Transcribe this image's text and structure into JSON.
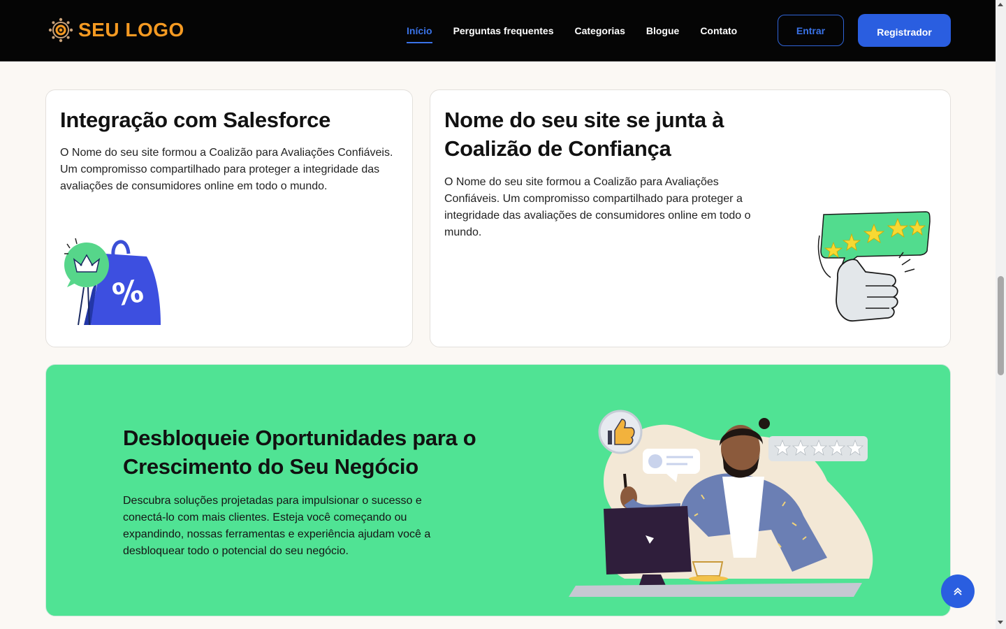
{
  "header": {
    "logo_text": "SEU LOGO",
    "nav": [
      {
        "label": "Início",
        "active": true
      },
      {
        "label": "Perguntas frequentes",
        "active": false
      },
      {
        "label": "Categorias",
        "active": false
      },
      {
        "label": "Blogue",
        "active": false
      },
      {
        "label": "Contato",
        "active": false
      }
    ],
    "login_label": "Entrar",
    "register_label": "Registrador"
  },
  "cards": [
    {
      "title": "Integração com Salesforce",
      "text": "O Nome do seu site formou a Coalizão para Avaliações Confiáveis. Um compromisso compartilhado para proteger a integridade das avaliações de consumidores online em todo o mundo.",
      "icon": "shopping-bag-discount-icon"
    },
    {
      "title": "Nome do seu site se junta à Coalizão de Confiança",
      "text": "O Nome do seu site formou a Coalizão para Avaliações Confiáveis. Um compromisso compartilhado para proteger a integridade das avaliações de consumidores online em todo o mundo.",
      "icon": "thumbs-up-stars-icon"
    }
  ],
  "banner": {
    "title": "Desbloqueie Oportunidades para o Crescimento do Seu Negócio",
    "text": "Descubra soluções projetadas para impulsionar o sucesso e conectá-lo com mais clientes. Esteja você começando ou expandindo, nossas ferramentas e experiência ajudam você a desbloquear todo o potencial do seu negócio.",
    "icon": "man-at-computer-review-icon"
  },
  "colors": {
    "header_bg": "#050505",
    "accent_blue": "#2a5ee0",
    "logo_orange": "#f59a22",
    "banner_green": "#50e394",
    "page_bg": "#fbf8f4"
  },
  "fab_icon": "chevron-double-up-icon"
}
